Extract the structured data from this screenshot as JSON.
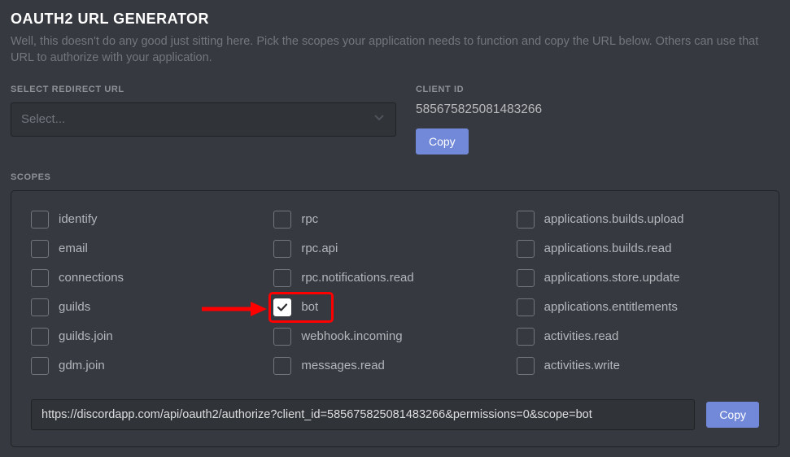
{
  "header": {
    "title": "OAUTH2 URL GENERATOR",
    "subtitle": "Well, this doesn't do any good just sitting here. Pick the scopes your application needs to function and copy the URL below. Others can use that URL to authorize with your application."
  },
  "redirect": {
    "label": "SELECT REDIRECT URL",
    "placeholder": "Select..."
  },
  "client": {
    "label": "CLIENT ID",
    "id": "585675825081483266",
    "copy_label": "Copy"
  },
  "scopes_label": "SCOPES",
  "scopes": {
    "col1": [
      {
        "label": "identify",
        "checked": false
      },
      {
        "label": "email",
        "checked": false
      },
      {
        "label": "connections",
        "checked": false
      },
      {
        "label": "guilds",
        "checked": false
      },
      {
        "label": "guilds.join",
        "checked": false
      },
      {
        "label": "gdm.join",
        "checked": false
      }
    ],
    "col2": [
      {
        "label": "rpc",
        "checked": false
      },
      {
        "label": "rpc.api",
        "checked": false
      },
      {
        "label": "rpc.notifications.read",
        "checked": false
      },
      {
        "label": "bot",
        "checked": true
      },
      {
        "label": "webhook.incoming",
        "checked": false
      },
      {
        "label": "messages.read",
        "checked": false
      }
    ],
    "col3": [
      {
        "label": "applications.builds.upload",
        "checked": false
      },
      {
        "label": "applications.builds.read",
        "checked": false
      },
      {
        "label": "applications.store.update",
        "checked": false
      },
      {
        "label": "applications.entitlements",
        "checked": false
      },
      {
        "label": "activities.read",
        "checked": false
      },
      {
        "label": "activities.write",
        "checked": false
      }
    ]
  },
  "generated": {
    "url": "https://discordapp.com/api/oauth2/authorize?client_id=585675825081483266&permissions=0&scope=bot",
    "copy_label": "Copy"
  }
}
